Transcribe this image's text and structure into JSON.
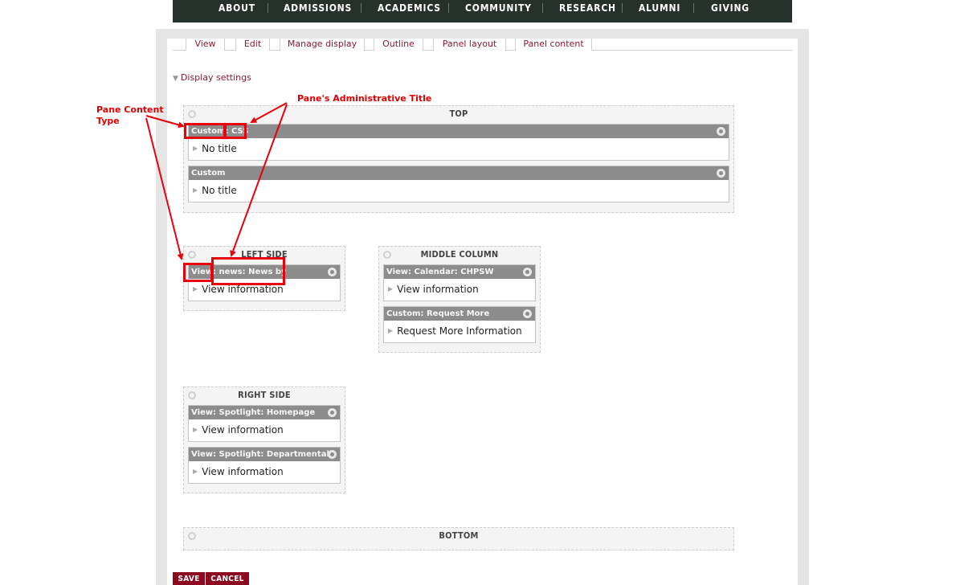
{
  "nav": {
    "items": [
      "ABOUT",
      "ADMISSIONS",
      "ACADEMICS",
      "COMMUNITY",
      "RESEARCH",
      "ALUMNI",
      "GIVING"
    ]
  },
  "tabs": [
    "View",
    "Edit",
    "Manage display",
    "Outline",
    "Panel layout",
    "Panel content"
  ],
  "display_settings": "Display settings",
  "annotations": {
    "content_type": "Pane Content Type",
    "admin_title": "Pane's Administrative Title"
  },
  "regions": {
    "top": {
      "title": "TOP",
      "panes": [
        {
          "type": "Custom:",
          "admin": "CSS",
          "body": "No title"
        },
        {
          "type": "Custom",
          "admin": "",
          "body": "No title"
        }
      ]
    },
    "left": {
      "title": "LEFT SIDE",
      "panes": [
        {
          "type": "View:",
          "admin": "news: News by",
          "body": "View information"
        }
      ]
    },
    "middle": {
      "title": "MIDDLE COLUMN",
      "panes": [
        {
          "type": "View:",
          "admin": "Calendar: CHPSW",
          "body": "View information"
        },
        {
          "type": "Custom:",
          "admin": "Request More",
          "body": "Request More Information"
        }
      ]
    },
    "right": {
      "title": "RIGHT SIDE",
      "panes": [
        {
          "type": "View:",
          "admin": "Spotlight: Homepage",
          "body": "View information"
        },
        {
          "type": "View:",
          "admin": "Spotlight: Departmental",
          "body": "View information"
        }
      ]
    },
    "bottom": {
      "title": "BOTTOM"
    }
  },
  "buttons": {
    "save": "SAVE",
    "cancel": "CANCEL"
  },
  "colors": {
    "nav_bg": "#26312b",
    "link": "#8c1a2e",
    "annotation": "#e8000b",
    "button": "#8c0a20",
    "pane_header": "#8c8c8c"
  }
}
